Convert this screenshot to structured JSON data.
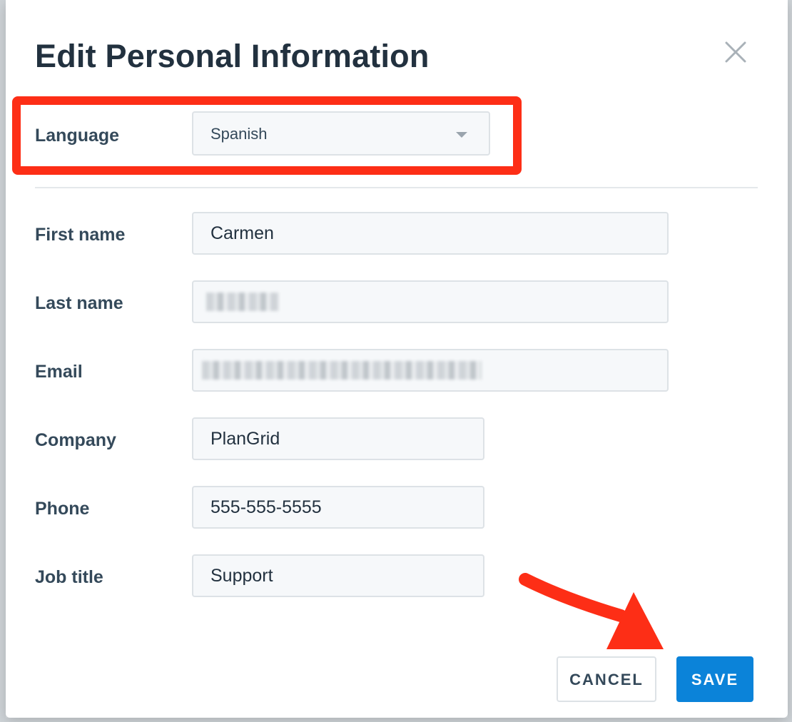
{
  "modal": {
    "title": "Edit Personal Information"
  },
  "form": {
    "language": {
      "label": "Language",
      "value": "Spanish"
    },
    "first_name": {
      "label": "First name",
      "value": "Carmen"
    },
    "last_name": {
      "label": "Last name",
      "value": ""
    },
    "email": {
      "label": "Email",
      "value": ""
    },
    "company": {
      "label": "Company",
      "value": "PlanGrid"
    },
    "phone": {
      "label": "Phone",
      "value": "555-555-5555"
    },
    "job_title": {
      "label": "Job title",
      "value": "Support"
    }
  },
  "actions": {
    "cancel_label": "CANCEL",
    "save_label": "SAVE"
  },
  "icons": {
    "close": "close-icon",
    "dropdown": "chevron-down-icon"
  },
  "colors": {
    "primary": "#0b83d9",
    "annotation": "#fd2e16",
    "title": "#22313f",
    "label": "#34495a",
    "input_bg": "#f6f8fa",
    "input_border": "#dde2e6"
  }
}
